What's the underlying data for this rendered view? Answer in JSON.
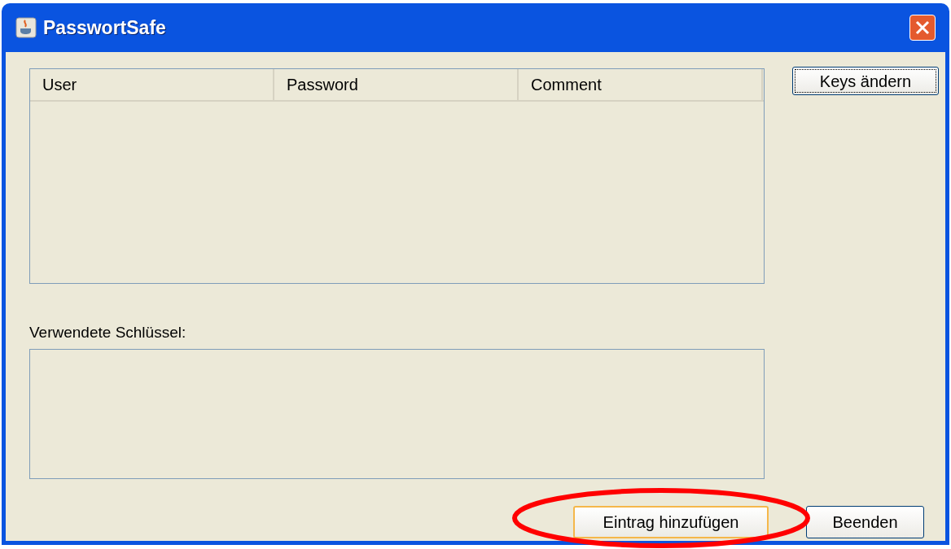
{
  "window": {
    "title": "PasswortSafe"
  },
  "table": {
    "columns": [
      "User",
      "Password",
      "Comment"
    ]
  },
  "keys_label": "Verwendete Schlüssel:",
  "buttons": [
    {
      "label": "Keys ändern",
      "kind": "side",
      "focused": true,
      "hovered": false
    },
    {
      "label": "Eintrag hinzufügen",
      "kind": "bottom",
      "focused": false,
      "hovered": true
    },
    {
      "label": "Beenden",
      "kind": "bottom",
      "focused": false,
      "hovered": false
    }
  ],
  "annotation": {
    "kind": "ellipse"
  }
}
